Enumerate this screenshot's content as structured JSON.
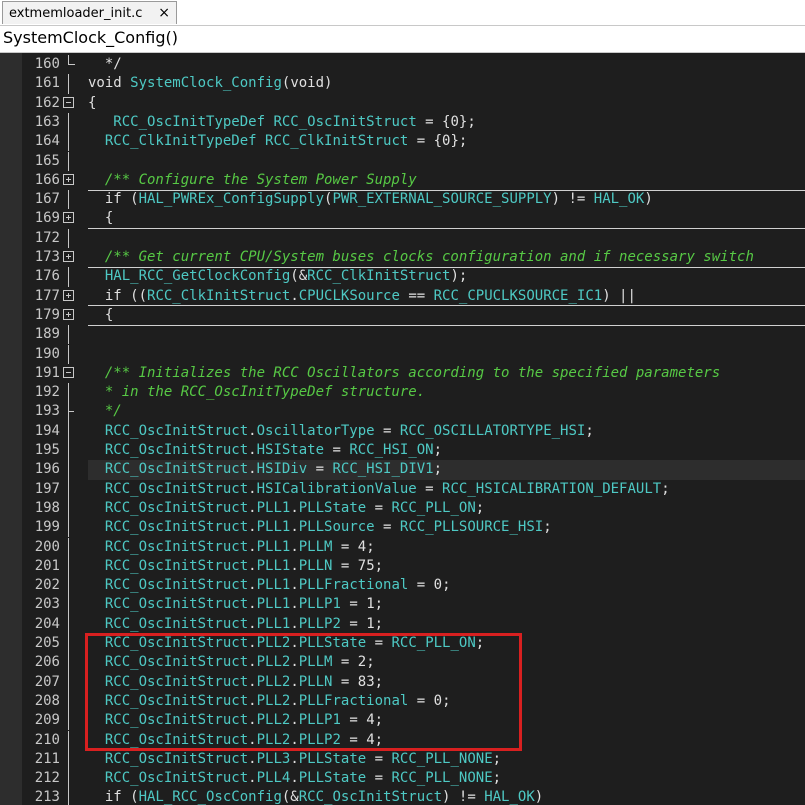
{
  "tab": {
    "label": "extmemloader_init.c",
    "close_glyph": "×"
  },
  "function_bar": {
    "label": "SystemClock_Config()"
  },
  "colors": {
    "background": "#1e1e1e",
    "type": "#4ec9c4",
    "comment": "#57c945",
    "highlight_box": "#d82020"
  },
  "lines": [
    {
      "num": "160",
      "fold": "end",
      "sep": false,
      "hl": false,
      "tokens": [
        [
          "m",
          "  */"
        ]
      ]
    },
    {
      "num": "161",
      "fold": "vline",
      "sep": false,
      "hl": false,
      "tokens": [
        [
          "k",
          "void "
        ],
        [
          "t",
          "SystemClock_Config"
        ],
        [
          "m",
          "("
        ],
        [
          "k",
          "void"
        ],
        [
          "m",
          ")"
        ]
      ]
    },
    {
      "num": "162",
      "fold": "minus",
      "sep": false,
      "hl": false,
      "tokens": [
        [
          "m",
          "{"
        ]
      ]
    },
    {
      "num": "163",
      "fold": "vline",
      "sep": false,
      "hl": false,
      "tokens": [
        [
          "m",
          "   "
        ],
        [
          "t",
          "RCC_OscInitTypeDef"
        ],
        [
          "m",
          " "
        ],
        [
          "t",
          "RCC_OscInitStruct"
        ],
        [
          "m",
          " = {"
        ],
        [
          "n",
          "0"
        ],
        [
          "m",
          "};"
        ]
      ]
    },
    {
      "num": "164",
      "fold": "vline",
      "sep": false,
      "hl": false,
      "tokens": [
        [
          "m",
          "  "
        ],
        [
          "t",
          "RCC_ClkInitTypeDef"
        ],
        [
          "m",
          " "
        ],
        [
          "t",
          "RCC_ClkInitStruct"
        ],
        [
          "m",
          " = {"
        ],
        [
          "n",
          "0"
        ],
        [
          "m",
          "};"
        ]
      ]
    },
    {
      "num": "165",
      "fold": "vline",
      "sep": false,
      "hl": false,
      "tokens": []
    },
    {
      "num": "166",
      "fold": "plus",
      "sep": false,
      "hl": false,
      "tokens": [
        [
          "c",
          "  /** Configure the System Power Supply"
        ]
      ]
    },
    {
      "num": "167",
      "fold": "vline",
      "sep": true,
      "hl": false,
      "tokens": [
        [
          "m",
          "  "
        ],
        [
          "k",
          "if"
        ],
        [
          "m",
          " ("
        ],
        [
          "t",
          "HAL_PWREx_ConfigSupply"
        ],
        [
          "m",
          "("
        ],
        [
          "t",
          "PWR_EXTERNAL_SOURCE_SUPPLY"
        ],
        [
          "m",
          ") != "
        ],
        [
          "t",
          "HAL_OK"
        ],
        [
          "m",
          ")"
        ]
      ]
    },
    {
      "num": "169",
      "fold": "plus",
      "sep": false,
      "hl": false,
      "tokens": [
        [
          "m",
          "  {"
        ]
      ]
    },
    {
      "num": "172",
      "fold": "vline",
      "sep": true,
      "hl": false,
      "tokens": []
    },
    {
      "num": "173",
      "fold": "plus",
      "sep": false,
      "hl": false,
      "tokens": [
        [
          "c",
          "  /** Get current CPU/System buses clocks configuration and if necessary switch"
        ]
      ]
    },
    {
      "num": "176",
      "fold": "vline",
      "sep": true,
      "hl": false,
      "tokens": [
        [
          "m",
          "  "
        ],
        [
          "t",
          "HAL_RCC_GetClockConfig"
        ],
        [
          "m",
          "(&"
        ],
        [
          "t",
          "RCC_ClkInitStruct"
        ],
        [
          "m",
          ");"
        ]
      ]
    },
    {
      "num": "177",
      "fold": "plus",
      "sep": false,
      "hl": false,
      "tokens": [
        [
          "m",
          "  "
        ],
        [
          "k",
          "if"
        ],
        [
          "m",
          " (("
        ],
        [
          "t",
          "RCC_ClkInitStruct"
        ],
        [
          "m",
          "."
        ],
        [
          "t",
          "CPUCLKSource"
        ],
        [
          "m",
          " == "
        ],
        [
          "t",
          "RCC_CPUCLKSOURCE_IC1"
        ],
        [
          "m",
          ") ||"
        ]
      ]
    },
    {
      "num": "179",
      "fold": "plus",
      "sep": true,
      "hl": false,
      "tokens": [
        [
          "m",
          "  {"
        ]
      ]
    },
    {
      "num": "189",
      "fold": "vline",
      "sep": true,
      "hl": false,
      "tokens": []
    },
    {
      "num": "190",
      "fold": "vline",
      "sep": false,
      "hl": false,
      "tokens": []
    },
    {
      "num": "191",
      "fold": "minus",
      "sep": false,
      "hl": false,
      "tokens": [
        [
          "c",
          "  /** Initializes the RCC Oscillators according to the specified parameters"
        ]
      ]
    },
    {
      "num": "192",
      "fold": "vline",
      "sep": false,
      "hl": false,
      "tokens": [
        [
          "c",
          "  * in the RCC_OscInitTypeDef structure."
        ]
      ]
    },
    {
      "num": "193",
      "fold": "tick",
      "sep": false,
      "hl": false,
      "tokens": [
        [
          "c",
          "  */"
        ]
      ]
    },
    {
      "num": "194",
      "fold": "vline",
      "sep": false,
      "hl": false,
      "tokens": [
        [
          "m",
          "  "
        ],
        [
          "t",
          "RCC_OscInitStruct"
        ],
        [
          "m",
          "."
        ],
        [
          "t",
          "OscillatorType"
        ],
        [
          "m",
          " = "
        ],
        [
          "t",
          "RCC_OSCILLATORTYPE_HSI"
        ],
        [
          "m",
          ";"
        ]
      ]
    },
    {
      "num": "195",
      "fold": "vline",
      "sep": false,
      "hl": false,
      "tokens": [
        [
          "m",
          "  "
        ],
        [
          "t",
          "RCC_OscInitStruct"
        ],
        [
          "m",
          "."
        ],
        [
          "t",
          "HSIState"
        ],
        [
          "m",
          " = "
        ],
        [
          "t",
          "RCC_HSI_ON"
        ],
        [
          "m",
          ";"
        ]
      ]
    },
    {
      "num": "196",
      "fold": "vline",
      "sep": false,
      "hl": true,
      "tokens": [
        [
          "m",
          "  "
        ],
        [
          "t",
          "RCC_OscInitStruct"
        ],
        [
          "m",
          "."
        ],
        [
          "t",
          "HSIDiv"
        ],
        [
          "m",
          " = "
        ],
        [
          "t",
          "RCC_HSI_DIV1"
        ],
        [
          "m",
          ";"
        ]
      ]
    },
    {
      "num": "197",
      "fold": "vline",
      "sep": false,
      "hl": false,
      "tokens": [
        [
          "m",
          "  "
        ],
        [
          "t",
          "RCC_OscInitStruct"
        ],
        [
          "m",
          "."
        ],
        [
          "t",
          "HSICalibrationValue"
        ],
        [
          "m",
          " = "
        ],
        [
          "t",
          "RCC_HSICALIBRATION_DEFAULT"
        ],
        [
          "m",
          ";"
        ]
      ]
    },
    {
      "num": "198",
      "fold": "vline",
      "sep": false,
      "hl": false,
      "tokens": [
        [
          "m",
          "  "
        ],
        [
          "t",
          "RCC_OscInitStruct"
        ],
        [
          "m",
          "."
        ],
        [
          "t",
          "PLL1"
        ],
        [
          "m",
          "."
        ],
        [
          "t",
          "PLLState"
        ],
        [
          "m",
          " = "
        ],
        [
          "t",
          "RCC_PLL_ON"
        ],
        [
          "m",
          ";"
        ]
      ]
    },
    {
      "num": "199",
      "fold": "vline",
      "sep": false,
      "hl": false,
      "tokens": [
        [
          "m",
          "  "
        ],
        [
          "t",
          "RCC_OscInitStruct"
        ],
        [
          "m",
          "."
        ],
        [
          "t",
          "PLL1"
        ],
        [
          "m",
          "."
        ],
        [
          "t",
          "PLLSource"
        ],
        [
          "m",
          " = "
        ],
        [
          "t",
          "RCC_PLLSOURCE_HSI"
        ],
        [
          "m",
          ";"
        ]
      ]
    },
    {
      "num": "200",
      "fold": "vline",
      "sep": false,
      "hl": false,
      "tokens": [
        [
          "m",
          "  "
        ],
        [
          "t",
          "RCC_OscInitStruct"
        ],
        [
          "m",
          "."
        ],
        [
          "t",
          "PLL1"
        ],
        [
          "m",
          "."
        ],
        [
          "t",
          "PLLM"
        ],
        [
          "m",
          " = "
        ],
        [
          "n",
          "4"
        ],
        [
          "m",
          ";"
        ]
      ]
    },
    {
      "num": "201",
      "fold": "vline",
      "sep": false,
      "hl": false,
      "tokens": [
        [
          "m",
          "  "
        ],
        [
          "t",
          "RCC_OscInitStruct"
        ],
        [
          "m",
          "."
        ],
        [
          "t",
          "PLL1"
        ],
        [
          "m",
          "."
        ],
        [
          "t",
          "PLLN"
        ],
        [
          "m",
          " = "
        ],
        [
          "n",
          "75"
        ],
        [
          "m",
          ";"
        ]
      ]
    },
    {
      "num": "202",
      "fold": "vline",
      "sep": false,
      "hl": false,
      "tokens": [
        [
          "m",
          "  "
        ],
        [
          "t",
          "RCC_OscInitStruct"
        ],
        [
          "m",
          "."
        ],
        [
          "t",
          "PLL1"
        ],
        [
          "m",
          "."
        ],
        [
          "t",
          "PLLFractional"
        ],
        [
          "m",
          " = "
        ],
        [
          "n",
          "0"
        ],
        [
          "m",
          ";"
        ]
      ]
    },
    {
      "num": "203",
      "fold": "vline",
      "sep": false,
      "hl": false,
      "tokens": [
        [
          "m",
          "  "
        ],
        [
          "t",
          "RCC_OscInitStruct"
        ],
        [
          "m",
          "."
        ],
        [
          "t",
          "PLL1"
        ],
        [
          "m",
          "."
        ],
        [
          "t",
          "PLLP1"
        ],
        [
          "m",
          " = "
        ],
        [
          "n",
          "1"
        ],
        [
          "m",
          ";"
        ]
      ]
    },
    {
      "num": "204",
      "fold": "vline",
      "sep": false,
      "hl": false,
      "tokens": [
        [
          "m",
          "  "
        ],
        [
          "t",
          "RCC_OscInitStruct"
        ],
        [
          "m",
          "."
        ],
        [
          "t",
          "PLL1"
        ],
        [
          "m",
          "."
        ],
        [
          "t",
          "PLLP2"
        ],
        [
          "m",
          " = "
        ],
        [
          "n",
          "1"
        ],
        [
          "m",
          ";"
        ]
      ]
    },
    {
      "num": "205",
      "fold": "vline",
      "sep": false,
      "hl": false,
      "tokens": [
        [
          "m",
          "  "
        ],
        [
          "t",
          "RCC_OscInitStruct"
        ],
        [
          "m",
          "."
        ],
        [
          "t",
          "PLL2"
        ],
        [
          "m",
          "."
        ],
        [
          "t",
          "PLLState"
        ],
        [
          "m",
          " = "
        ],
        [
          "t",
          "RCC_PLL_ON"
        ],
        [
          "m",
          ";"
        ]
      ]
    },
    {
      "num": "206",
      "fold": "vline",
      "sep": false,
      "hl": false,
      "tokens": [
        [
          "m",
          "  "
        ],
        [
          "t",
          "RCC_OscInitStruct"
        ],
        [
          "m",
          "."
        ],
        [
          "t",
          "PLL2"
        ],
        [
          "m",
          "."
        ],
        [
          "t",
          "PLLM"
        ],
        [
          "m",
          " = "
        ],
        [
          "n",
          "2"
        ],
        [
          "m",
          ";"
        ]
      ]
    },
    {
      "num": "207",
      "fold": "vline",
      "sep": false,
      "hl": false,
      "tokens": [
        [
          "m",
          "  "
        ],
        [
          "t",
          "RCC_OscInitStruct"
        ],
        [
          "m",
          "."
        ],
        [
          "t",
          "PLL2"
        ],
        [
          "m",
          "."
        ],
        [
          "t",
          "PLLN"
        ],
        [
          "m",
          " = "
        ],
        [
          "n",
          "83"
        ],
        [
          "m",
          ";"
        ]
      ]
    },
    {
      "num": "208",
      "fold": "vline",
      "sep": false,
      "hl": false,
      "tokens": [
        [
          "m",
          "  "
        ],
        [
          "t",
          "RCC_OscInitStruct"
        ],
        [
          "m",
          "."
        ],
        [
          "t",
          "PLL2"
        ],
        [
          "m",
          "."
        ],
        [
          "t",
          "PLLFractional"
        ],
        [
          "m",
          " = "
        ],
        [
          "n",
          "0"
        ],
        [
          "m",
          ";"
        ]
      ]
    },
    {
      "num": "209",
      "fold": "vline",
      "sep": false,
      "hl": false,
      "tokens": [
        [
          "m",
          "  "
        ],
        [
          "t",
          "RCC_OscInitStruct"
        ],
        [
          "m",
          "."
        ],
        [
          "t",
          "PLL2"
        ],
        [
          "m",
          "."
        ],
        [
          "t",
          "PLLP1"
        ],
        [
          "m",
          " = "
        ],
        [
          "n",
          "4"
        ],
        [
          "m",
          ";"
        ]
      ]
    },
    {
      "num": "210",
      "fold": "vline",
      "sep": false,
      "hl": false,
      "tokens": [
        [
          "m",
          "  "
        ],
        [
          "t",
          "RCC_OscInitStruct"
        ],
        [
          "m",
          "."
        ],
        [
          "t",
          "PLL2"
        ],
        [
          "m",
          "."
        ],
        [
          "t",
          "PLLP2"
        ],
        [
          "m",
          " = "
        ],
        [
          "n",
          "4"
        ],
        [
          "m",
          ";"
        ]
      ]
    },
    {
      "num": "211",
      "fold": "vline",
      "sep": false,
      "hl": false,
      "tokens": [
        [
          "m",
          "  "
        ],
        [
          "t",
          "RCC_OscInitStruct"
        ],
        [
          "m",
          "."
        ],
        [
          "t",
          "PLL3"
        ],
        [
          "m",
          "."
        ],
        [
          "t",
          "PLLState"
        ],
        [
          "m",
          " = "
        ],
        [
          "t",
          "RCC_PLL_NONE"
        ],
        [
          "m",
          ";"
        ]
      ]
    },
    {
      "num": "212",
      "fold": "vline",
      "sep": false,
      "hl": false,
      "tokens": [
        [
          "m",
          "  "
        ],
        [
          "t",
          "RCC_OscInitStruct"
        ],
        [
          "m",
          "."
        ],
        [
          "t",
          "PLL4"
        ],
        [
          "m",
          "."
        ],
        [
          "t",
          "PLLState"
        ],
        [
          "m",
          " = "
        ],
        [
          "t",
          "RCC_PLL_NONE"
        ],
        [
          "m",
          ";"
        ]
      ]
    },
    {
      "num": "213",
      "fold": "vline",
      "sep": false,
      "hl": false,
      "tokens": [
        [
          "m",
          "  "
        ],
        [
          "k",
          "if"
        ],
        [
          "m",
          " ("
        ],
        [
          "t",
          "HAL_RCC_OscConfig"
        ],
        [
          "m",
          "(&"
        ],
        [
          "t",
          "RCC_OscInitStruct"
        ],
        [
          "m",
          ") != "
        ],
        [
          "t",
          "HAL_OK"
        ],
        [
          "m",
          ")"
        ]
      ]
    }
  ]
}
